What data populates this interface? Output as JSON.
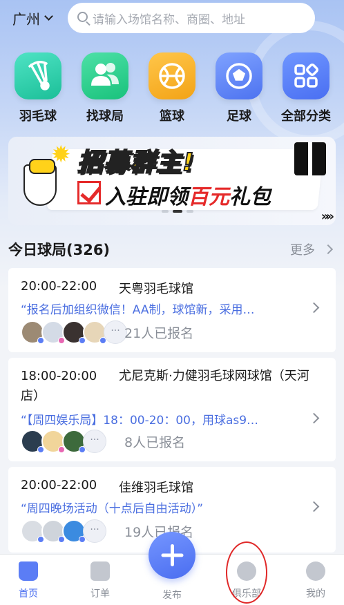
{
  "header": {
    "city": "广州",
    "search_placeholder": "请输入场馆名称、商圈、地址"
  },
  "categories": [
    {
      "label": "羽毛球",
      "icon": "shuttlecock-icon"
    },
    {
      "label": "找球局",
      "icon": "people-icon"
    },
    {
      "label": "篮球",
      "icon": "basketball-icon"
    },
    {
      "label": "足球",
      "icon": "soccer-icon"
    },
    {
      "label": "全部分类",
      "icon": "grid-icon"
    }
  ],
  "banner": {
    "line1": "招募群主!",
    "line2_prefix": "入驻即领",
    "line2_red": "百元",
    "line2_suffix": "礼包",
    "arrows": "»»"
  },
  "section": {
    "title": "今日球局(326)",
    "more": "更多"
  },
  "games": [
    {
      "time": "20:00-22:00",
      "venue": "天粤羽毛球馆",
      "desc": "“报名后加组织微信！AA制，球馆新，采用…",
      "signed": "21人已报名",
      "more_avatars": "···"
    },
    {
      "time": "18:00-20:00",
      "venue": "尤尼克斯·力健羽毛球网球馆（天河店）",
      "desc": "“【周四娱乐局】18：00-20：00，用球as9…",
      "signed": "8人已报名",
      "more_avatars": "···"
    },
    {
      "time": "20:00-22:00",
      "venue": "佳维羽毛球馆",
      "desc": "“周四晚场活动（十点后自由活动）”",
      "signed": "19人已报名",
      "more_avatars": "···"
    }
  ],
  "tabbar": {
    "home": "首页",
    "orders": "订单",
    "publish": "发布",
    "club": "俱乐部",
    "mine": "我的"
  },
  "colors": {
    "accent": "#4a6ef0",
    "link_text": "#4a6ee0",
    "annotation_ring": "#e02828"
  }
}
